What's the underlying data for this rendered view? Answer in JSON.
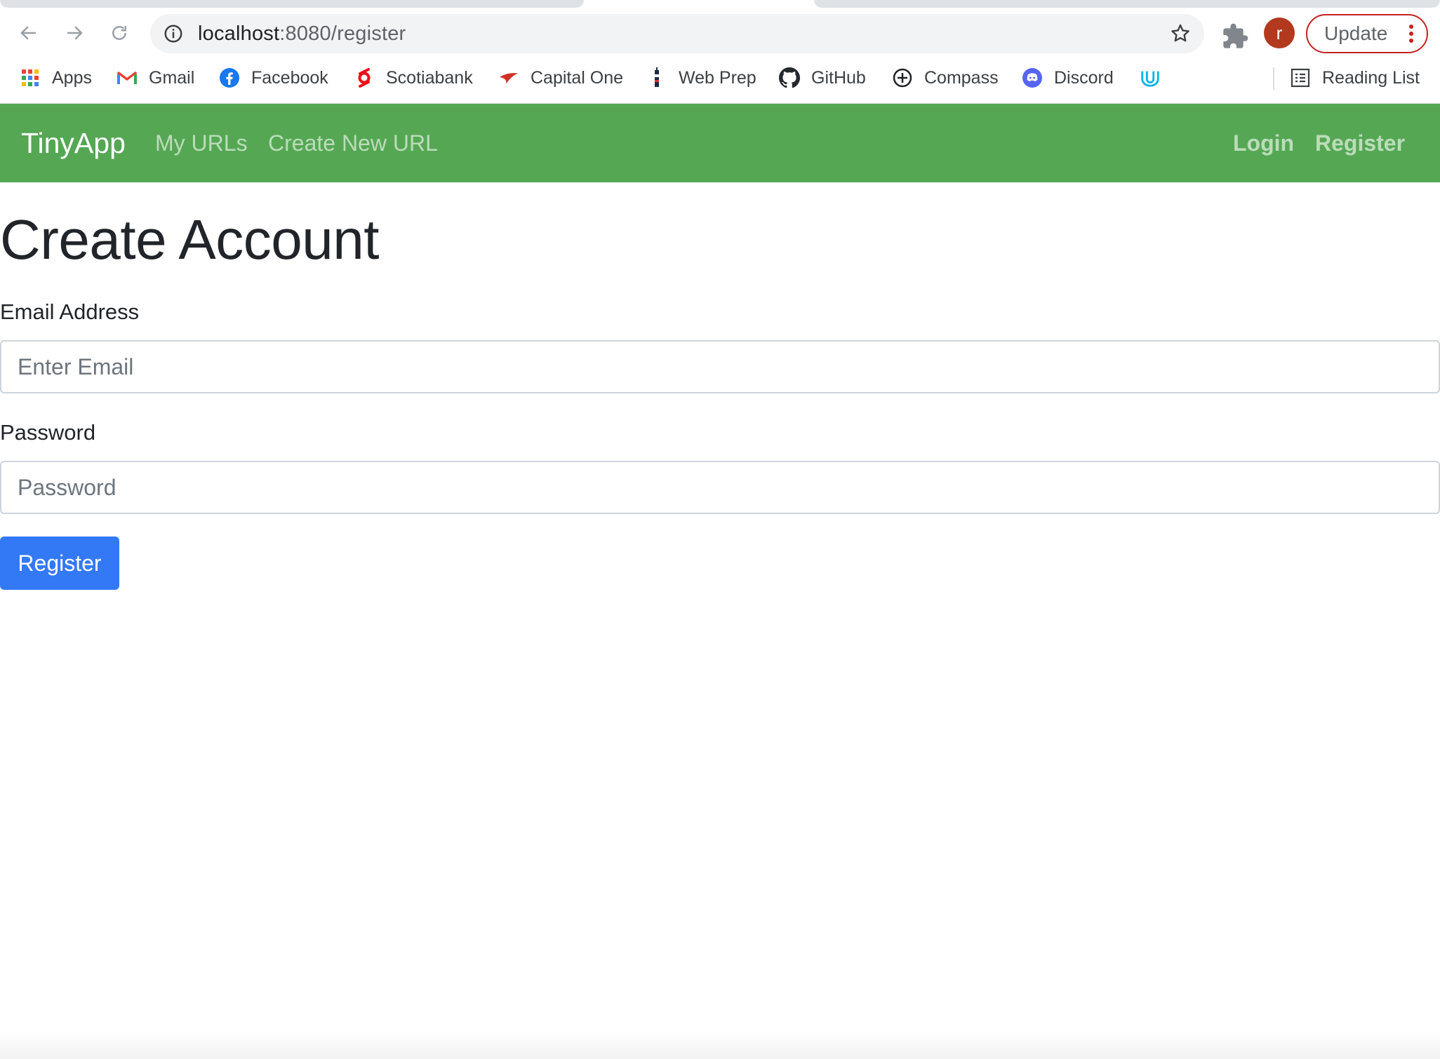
{
  "browser": {
    "url_host": "localhost",
    "url_rest": ":8080/register",
    "avatar_letter": "r",
    "update_label": "Update",
    "bookmarks": [
      {
        "label": "Apps",
        "icon": "apps-grid-icon"
      },
      {
        "label": "Gmail",
        "icon": "gmail-icon"
      },
      {
        "label": "Facebook",
        "icon": "facebook-icon"
      },
      {
        "label": "Scotiabank",
        "icon": "scotiabank-icon"
      },
      {
        "label": "Capital One",
        "icon": "capital-one-icon"
      },
      {
        "label": "Web Prep",
        "icon": "web-prep-icon"
      },
      {
        "label": "GitHub",
        "icon": "github-icon"
      },
      {
        "label": "Compass",
        "icon": "compass-icon"
      },
      {
        "label": "Discord",
        "icon": "discord-icon"
      },
      {
        "label": "",
        "icon": "udacity-icon"
      }
    ],
    "reading_list": "Reading List"
  },
  "navbar": {
    "brand": "TinyApp",
    "links": [
      "My URLs",
      "Create New URL"
    ],
    "right_links": [
      "Login",
      "Register"
    ],
    "color": "#55a754"
  },
  "form": {
    "title": "Create Account",
    "email_label": "Email Address",
    "email_placeholder": "Enter Email",
    "email_value": "",
    "password_label": "Password",
    "password_placeholder": "Password",
    "password_value": "",
    "submit_label": "Register",
    "submit_color": "#3379f6"
  }
}
